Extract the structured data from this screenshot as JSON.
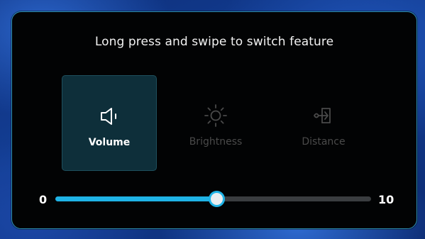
{
  "title": "Long press and swipe to switch feature",
  "features": [
    {
      "label": "Volume",
      "icon": "speaker-icon",
      "selected": true
    },
    {
      "label": "Brightness",
      "icon": "sun-icon",
      "selected": false
    },
    {
      "label": "Distance",
      "icon": "distance-icon",
      "selected": false
    }
  ],
  "slider": {
    "min_label": "0",
    "max_label": "10",
    "min": 0,
    "max": 10,
    "value": 5.1
  },
  "colors": {
    "accent": "#1fb3e6",
    "panel_border": "#2c8fb4",
    "selected_tile": "#0e2f3a",
    "dim_text": "#4a4a4a"
  }
}
